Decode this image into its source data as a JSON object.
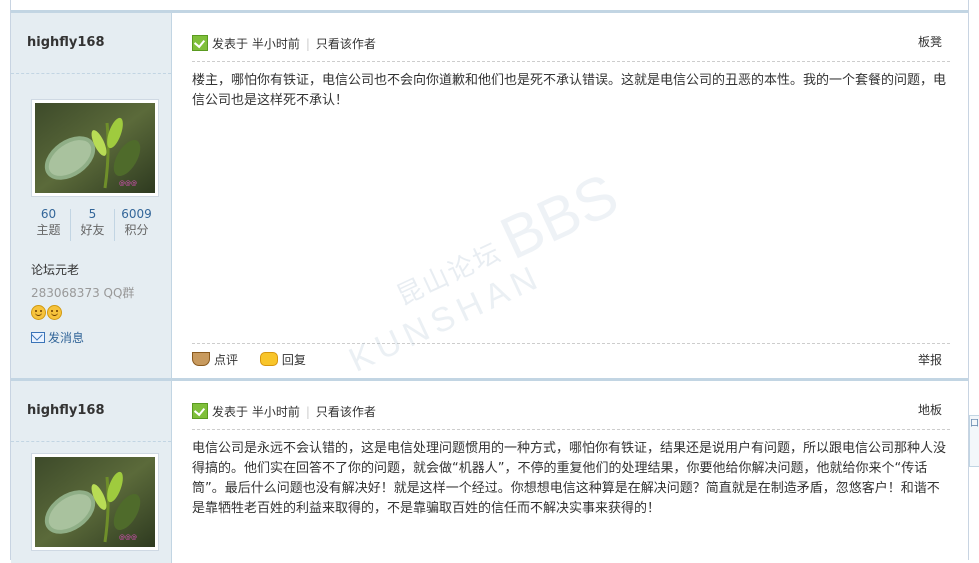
{
  "watermark": {
    "zh": "昆山论坛",
    "en": "KUNSHAN",
    "bbs": "BBS"
  },
  "side_tab": "口",
  "posts": [
    {
      "author": "highfly168",
      "stats": [
        {
          "value": "60",
          "label": "主题"
        },
        {
          "value": "5",
          "label": "好友"
        },
        {
          "value": "6009",
          "label": "积分"
        }
      ],
      "rank": "论坛元老",
      "qq": "283068373 QQ群",
      "pm_label": "发消息",
      "posted_label": "发表于",
      "time": "半小时前",
      "author_only": "只看该作者",
      "floor": "板凳",
      "message": "楼主，哪怕你有铁证，电信公司也不会向你道歉和他们也是死不承认错误。这就是电信公司的丑恶的本性。我的一个套餐的问题，电信公司也是这样死不承认！",
      "rate_label": "点评",
      "reply_label": "回复",
      "report_label": "举报"
    },
    {
      "author": "highfly168",
      "posted_label": "发表于",
      "time": "半小时前",
      "author_only": "只看该作者",
      "floor": "地板",
      "message": "电信公司是永远不会认错的，这是电信处理问题惯用的一种方式，哪怕你有铁证，结果还是说用户有问题，所以跟电信公司那种人没得搞的。他们实在回答不了你的问题，就会做“机器人”，不停的重复他们的处理结果，你要他给你解决问题，他就给你来个“传话筒”。最后什么问题也没有解决好！就是这样一个经过。你想想电信这种算是在解决问题？简直就是在制造矛盾，忽悠客户！和谐不是靠牺牲老百姓的利益来取得的，不是靠骗取百姓的信任而不解决实事来获得的！"
    }
  ]
}
